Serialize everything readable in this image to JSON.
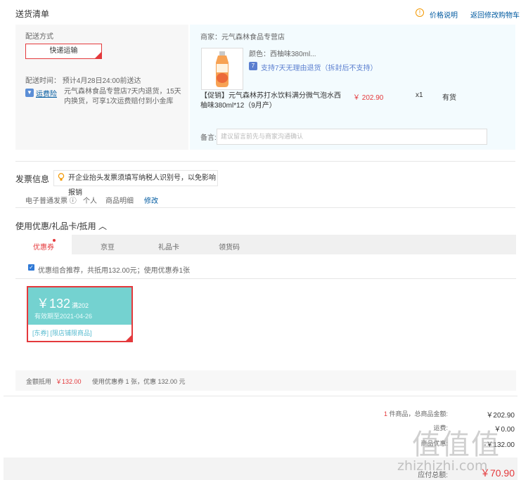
{
  "header": {
    "title": "送货清单",
    "price_note": "价格说明",
    "back_cart": "返回修改购物车",
    "price_note_icon": "!"
  },
  "delivery": {
    "method_label": "配送方式",
    "method_button": "快递运输",
    "time_text": "配送时间：   预计4月28日24:00前送达",
    "freight_icon": "▼",
    "freight_link": "运费险",
    "freight_desc": "元气森林食品专营店7天内退货，15天内换货，可享1次运费赔付到小金库"
  },
  "item": {
    "shop": "商家：元气森林食品专营店",
    "color": "颜色：西柚味380ml...",
    "return_icon": "7",
    "return_policy": "支持7天无理由退货（拆封后不支持）",
    "name": "【促销】元气森林苏打水饮料满分微气泡水西柚味380ml*12（9月产）",
    "price": "￥ 202.90",
    "qty": "x1",
    "stock": "有货",
    "remark_label": "备言:",
    "remark_placeholder": "建议留言前先与商家沟通确认"
  },
  "invoice": {
    "title": "发票信息",
    "tip": "开企业抬头发票须填写纳税人识别号，以免影响报销",
    "type": "电子普通发票 ⓘ",
    "person": "个人",
    "detail": "商品明细",
    "edit": "修改"
  },
  "coupons": {
    "title": "使用优惠/礼品卡/抵用 ︿",
    "tabs": [
      "优惠券",
      "京豆",
      "礼品卡",
      "领货码"
    ],
    "checkbox_mark": "✓",
    "recommend": "优惠组合推荐，共抵用132.00元；使用优惠券1张",
    "coupon": {
      "amount": "￥132",
      "condition": "满202",
      "expiry": "有效期至2021-04-26",
      "tags": "[东券] [限店铺限商品]"
    },
    "summary_label": "金额抵用",
    "summary_amount": "￥132.00",
    "summary_desc": "使用优惠券 1 张，优惠 132.00 元"
  },
  "totals": {
    "goods_label_count": "1",
    "goods_label": " 件商品，总商品金额:",
    "goods_value": "￥202.90",
    "row2_label": "运费:",
    "row2_value": "￥0.00",
    "row3_label": "商品优惠:",
    "row3_value": "-￥132.00",
    "pay_label": "应付总额:",
    "pay_value": "￥70.90"
  },
  "watermark": {
    "logo": "值值值",
    "url": "zhizhizhi.com"
  },
  "colors": {
    "accent_red": "#e4393c",
    "link_blue": "#005aa0",
    "coupon_teal": "#74d2d0"
  }
}
